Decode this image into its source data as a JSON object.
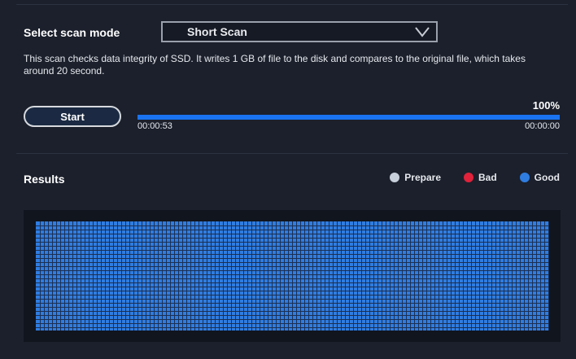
{
  "scan_mode": {
    "label": "Select scan mode",
    "selected": "Short Scan"
  },
  "description": "This scan checks data integrity of SSD. It writes 1 GB of file to the disk and compares to the original file, which takes around 20 second.",
  "progress": {
    "start_label": "Start",
    "percent_text": "100%",
    "percent_value": 100,
    "elapsed": "00:00:53",
    "remaining": "00:00:00"
  },
  "results": {
    "label": "Results",
    "legend": [
      {
        "name": "Prepare",
        "color": "#c8d0dc"
      },
      {
        "name": "Bad",
        "color": "#e0223a"
      },
      {
        "name": "Good",
        "color": "#2f7de1"
      }
    ],
    "grid": {
      "state": "Good",
      "good_color": "#2f7de1",
      "line_color": "#1d2f50"
    }
  },
  "icons": {
    "dropdown": "chevron-down-icon"
  }
}
